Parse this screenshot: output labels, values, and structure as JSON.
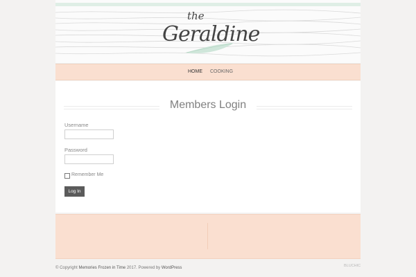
{
  "site": {
    "logo_small": "the",
    "logo_name": "Geraldine"
  },
  "nav": {
    "items": [
      {
        "label": "HOME",
        "active": true
      },
      {
        "label": "COOKING",
        "active": false
      }
    ]
  },
  "page": {
    "title": "Members Login"
  },
  "login_form": {
    "username_label": "Username",
    "username_value": "",
    "password_label": "Password",
    "password_value": "",
    "remember_label": "Remember Me",
    "remember_checked": false,
    "submit_label": "Log In"
  },
  "footer": {
    "copyright_prefix": "© Copyright",
    "site_link": "Memories Frozen in Time",
    "year_text": "2017.",
    "powered_text": "Powered by",
    "powered_link": "WordPress",
    "credit": "BLUCHIC"
  },
  "colors": {
    "page_bg": "#f3f2f1",
    "accent_peach": "#fadfd0",
    "header_green": "#dfeee6",
    "button_bg": "#5b5b5b"
  }
}
